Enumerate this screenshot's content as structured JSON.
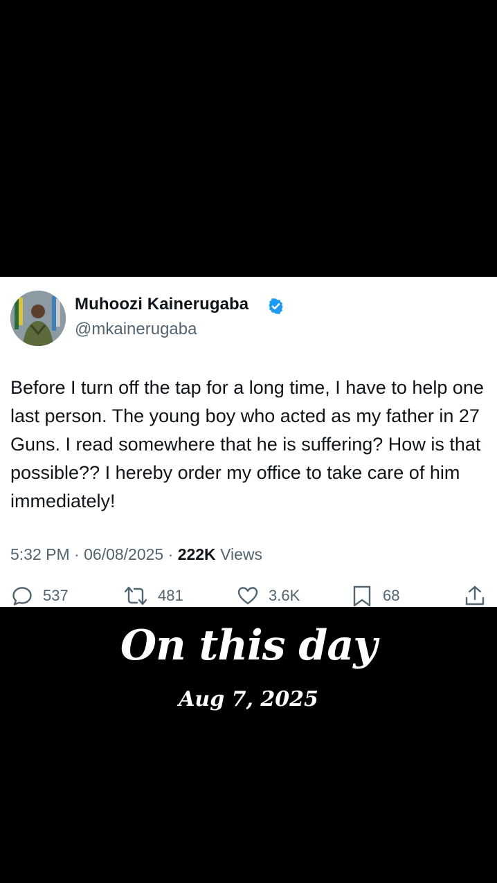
{
  "tweet": {
    "author": {
      "display_name": "Muhoozi Kainerugaba",
      "handle": "@mkainerugaba",
      "verified": true,
      "avatar_icon": "profile-photo"
    },
    "text": "Before I turn off the tap for a long time, I have to help one last person. The young boy who acted as my father in 27 Guns. I read somewhere that he is suffering? How is that possible?? I hereby order my office to take care of him immediately!",
    "time": "5:32 PM",
    "separator": "·",
    "date": "06/08/2025",
    "views_count": "222K",
    "views_label": "Views",
    "actions": {
      "replies": "537",
      "reposts": "481",
      "likes": "3.6K",
      "bookmarks": "68"
    }
  },
  "overlay": {
    "title": "On this day",
    "date": "Aug 7, 2025"
  },
  "colors": {
    "background": "#000000",
    "card": "#ffffff",
    "text_primary": "#0f1419",
    "text_secondary": "#536471",
    "verified_blue": "#1d9bf0"
  }
}
